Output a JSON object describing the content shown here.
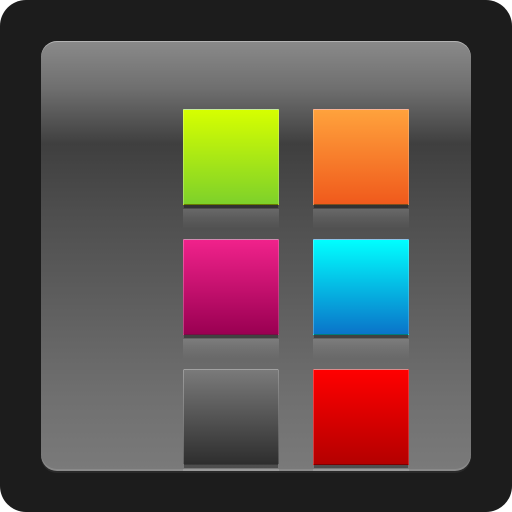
{
  "icon": {
    "name": "color-palette-grid",
    "frame_color": "#1C1C1C",
    "panel_color_top": "#8A8A8A",
    "panel_color_mid": "#3F3F3F",
    "panel_color_bottom": "#7A7A7A"
  },
  "tiles": [
    {
      "id": "lime",
      "top": "#D6FF00",
      "bottom": "#7ED12A"
    },
    {
      "id": "orange",
      "top": "#FFA23C",
      "bottom": "#F05A1C"
    },
    {
      "id": "magenta",
      "top": "#F0228B",
      "bottom": "#9A0052"
    },
    {
      "id": "cyan",
      "top": "#00FFFF",
      "bottom": "#0A74C9"
    },
    {
      "id": "dark",
      "top": "#7A7A7A",
      "bottom": "#2E2E2E"
    },
    {
      "id": "red",
      "top": "#FF0000",
      "bottom": "#B40000"
    }
  ]
}
